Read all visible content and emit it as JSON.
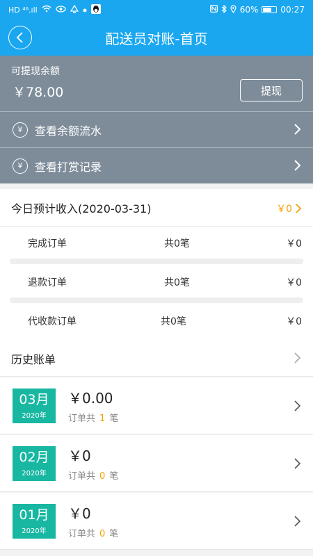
{
  "status_bar": {
    "left_text": "HD ⁴⁶.ıll",
    "battery_pct": "60%",
    "time": "00:27"
  },
  "nav": {
    "title": "配送员对账-首页"
  },
  "balance": {
    "label": "可提现余额",
    "value": "￥78.00",
    "withdraw_label": "提现"
  },
  "menu": [
    {
      "label": "查看余额流水",
      "icon": "yen-circle-icon"
    },
    {
      "label": "查看打赏记录",
      "icon": "yen-circle-icon"
    }
  ],
  "today": {
    "title": "今日预计收入(2020-03-31)",
    "total": "￥0",
    "rows": [
      {
        "name": "完成订单",
        "count": "共0笔",
        "amount": "￥0"
      },
      {
        "name": "退款订单",
        "count": "共0笔",
        "amount": "￥0"
      },
      {
        "name": "代收款订单",
        "count": "共0笔",
        "amount": "￥0"
      }
    ]
  },
  "history": {
    "title": "历史账单",
    "months": [
      {
        "month": "03月",
        "year": "2020年",
        "amount": "￥0.00",
        "orders_prefix": "订单共",
        "orders_count": "1",
        "orders_suffix": "笔"
      },
      {
        "month": "02月",
        "year": "2020年",
        "amount": "￥0",
        "orders_prefix": "订单共",
        "orders_count": "0",
        "orders_suffix": "笔"
      },
      {
        "month": "01月",
        "year": "2020年",
        "amount": "￥0",
        "orders_prefix": "订单共",
        "orders_count": "0",
        "orders_suffix": "笔"
      }
    ]
  },
  "colors": {
    "header_blue": "#1aa7f0",
    "card_gray": "#7e8c9a",
    "accent_orange": "#f2a000",
    "badge_teal": "#17b7a2"
  }
}
